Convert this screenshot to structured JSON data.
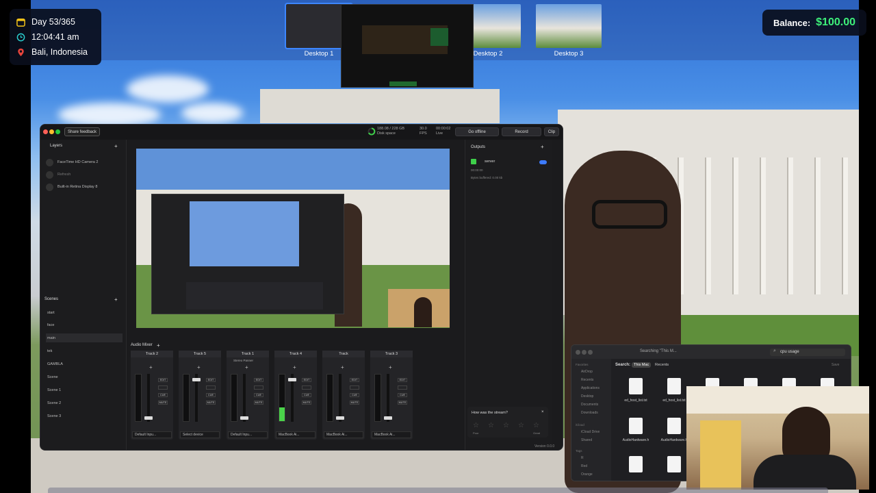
{
  "hud": {
    "day": "Day 53/365",
    "time": "12:04:41 am",
    "location": "Bali, Indonesia",
    "colors": {
      "calendar": "#f5c518",
      "clock": "#2ad0d0",
      "pin": "#e8453c"
    }
  },
  "balance": {
    "label": "Balance:",
    "value": "$100.00",
    "value_color": "#3ef07a"
  },
  "mission_control": {
    "desktops": [
      {
        "label": "Desktop 1",
        "selected": true
      },
      {
        "label": "Desktop 2",
        "selected": false
      },
      {
        "label": "Desktop 3",
        "selected": false
      }
    ]
  },
  "app": {
    "share_feedback": "Share feedback",
    "disk": "188.08 / 228 GB",
    "disk_label": "Disk space",
    "fps": "30.0",
    "fps_label": "FPS",
    "live_time": "00:00:02",
    "live_label": "Live",
    "go_offline": "Go offline",
    "record": "Record",
    "clip": "Clip",
    "layers_title": "Layers",
    "layers": [
      "FaceTime HD Camera 2",
      "Refresh",
      "Built-in Retina Display 8"
    ],
    "scenes_title": "Scenes",
    "scenes": [
      "start",
      "face",
      "main",
      "tek",
      "GAMBLA",
      "Scene",
      "Scene 1",
      "Scene 2",
      "Scene 3"
    ],
    "active_scene": "main",
    "audio_mixer_title": "Audio Mixer",
    "tracks": [
      {
        "name": "Track 2",
        "source": "Default Inpu...",
        "level": 0.0
      },
      {
        "name": "Track 5",
        "source": "Select device",
        "level": 0.0
      },
      {
        "name": "Track 1",
        "source": "Default Inpu...",
        "level": 0.0,
        "tag": "Stereo Panner"
      },
      {
        "name": "Track 4",
        "source": "MacBook Ai...",
        "level": 0.3
      },
      {
        "name": "Track",
        "source": "MacBook Ai...",
        "level": 0.0
      },
      {
        "name": "Track 3",
        "source": "MacBook Ai...",
        "level": 0.0
      }
    ],
    "outputs_title": "Outputs",
    "output_name": "server",
    "output_status": "00:00:00",
    "output_detail": "Bytes buffered: 0.00 kb",
    "rating_question": "How was the stream?",
    "rating_low": "Poor",
    "rating_high": "Great",
    "version": "Version 0.0.0"
  },
  "finder": {
    "title": "Searching \"This M...",
    "search_value": "cpu usage",
    "search_label": "Search:",
    "scope_this_mac": "This Mac",
    "scope_recents": "Recents",
    "save_label": "Save",
    "sidebar_favorites": "Favorites",
    "sidebar": [
      "AirDrop",
      "Recents",
      "Applications",
      "Desktop",
      "Documents",
      "Downloads"
    ],
    "sidebar_icloud_header": "iCloud",
    "icloud": [
      "iCloud Drive",
      "Shared"
    ],
    "tags_header": "Tags",
    "tags": [
      "R",
      "Red",
      "Orange"
    ],
    "files": [
      "ed_host_list.txt",
      "ed_host_list.txt",
      "AudioHardware.h",
      "AudioHardware.h"
    ]
  }
}
